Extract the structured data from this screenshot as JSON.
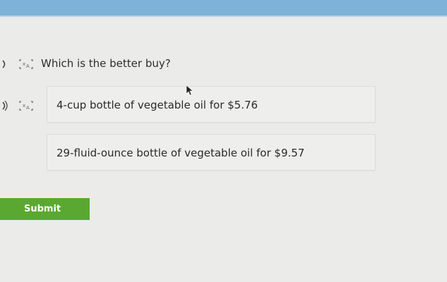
{
  "question": {
    "text": "Which is the better buy?",
    "audio_icon": "speaker-icon",
    "translate_icon": "translate-icon"
  },
  "options": [
    {
      "label": "4-cup bottle of vegetable oil for $5.76",
      "audio_icon": "speaker-icon",
      "translate_icon": "translate-icon"
    },
    {
      "label": "29-fluid-ounce bottle of vegetable oil for $9.57"
    }
  ],
  "submit": {
    "label": "Submit"
  },
  "colors": {
    "top_bar": "#7fb2d8",
    "background": "#ebebea",
    "submit_button": "#5aa832",
    "option_border": "#dcdcdb"
  }
}
